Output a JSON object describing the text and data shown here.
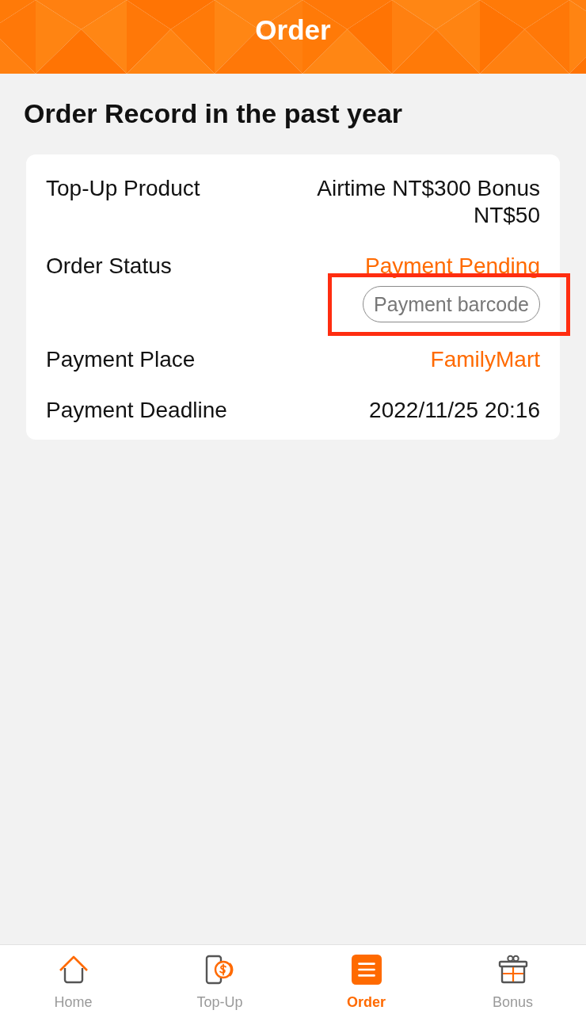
{
  "header": {
    "title": "Order"
  },
  "heading": "Order Record in the past year",
  "order": {
    "fields": [
      {
        "kind": "plain",
        "label": "Top-Up Product",
        "value": "Airtime NT$300 Bonus NT$50"
      },
      {
        "kind": "accent",
        "label": "Order Status",
        "value": "Payment Pending",
        "action": {
          "label": "Payment barcode",
          "highlighted": true
        }
      },
      {
        "kind": "accent",
        "label": "Payment Place",
        "value": "FamilyMart"
      },
      {
        "kind": "plain",
        "label": "Payment Deadline",
        "value": "2022/11/25 20:16"
      }
    ]
  },
  "tab_bar": {
    "tabs": [
      {
        "label": "Home",
        "selected": false
      },
      {
        "label": "Top-Up",
        "selected": false
      },
      {
        "label": "Order",
        "selected": true
      },
      {
        "label": "Bonus",
        "selected": false
      }
    ]
  }
}
